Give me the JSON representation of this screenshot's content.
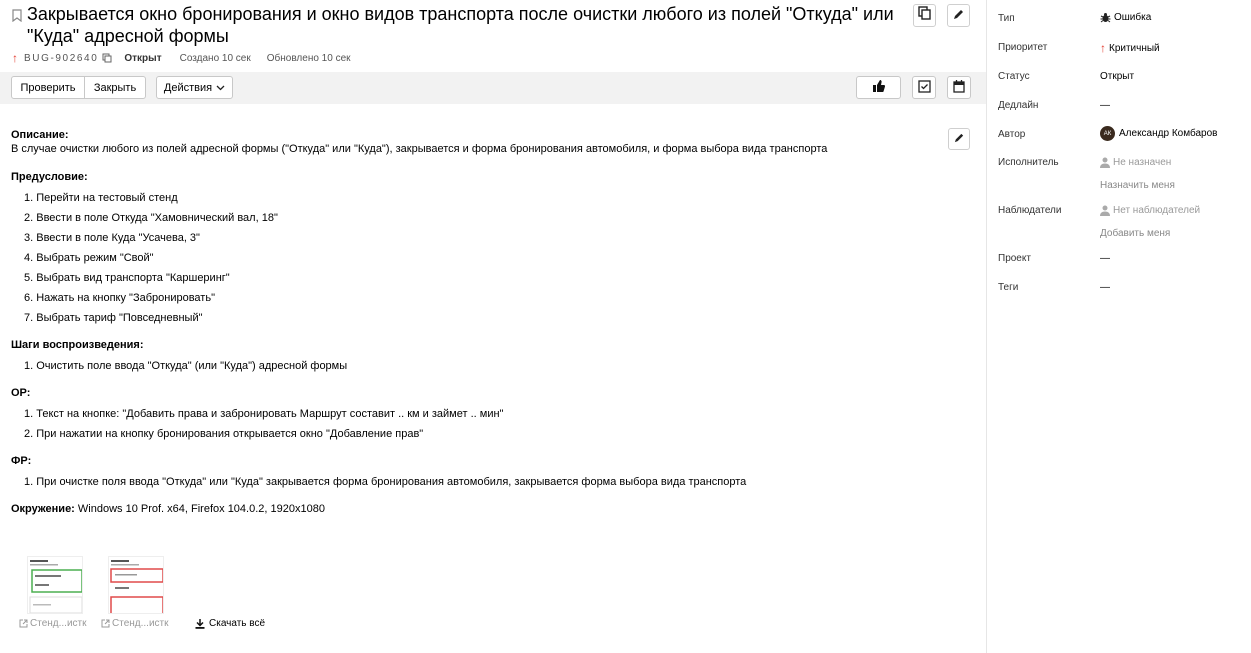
{
  "issue": {
    "title": "Закрывается окно бронирования и окно видов транспорта после очистки любого из полей \"Откуда\" или \"Куда\" адресной формы",
    "key": "BUG-902640",
    "status": "Открыт",
    "created": "Создано 10 сек",
    "updated": "Обновлено 10 сек"
  },
  "toolbar": {
    "check_label": "Проверить",
    "close_label": "Закрыть",
    "actions_label": "Действия"
  },
  "description": {
    "desc_heading": "Описание:",
    "desc_text": "В случае очистки любого из полей адресной формы (\"Откуда\" или \"Куда\"), закрывается и форма бронирования автомобиля, и форма выбора вида транспорта",
    "precondition_heading": "Предусловие:",
    "precondition_steps": [
      "1. Перейти на тестовый стенд",
      "2. Ввести в поле Откуда \"Хамовнический вал, 18\"",
      "3. Ввести в поле Куда \"Усачева, 3\"",
      "4. Выбрать режим \"Свой\"",
      "5. Выбрать вид транспорта \"Каршеринг\"",
      "6. Нажать на кнопку \"Забронировать\"",
      "7. Выбрать тариф \"Повседневный\""
    ],
    "repro_heading": "Шаги воспроизведения:",
    "repro_steps": [
      "1. Очистить поле ввода \"Откуда\" (или \"Куда\") адресной формы"
    ],
    "actual_heading": "ОР:",
    "actual_steps": [
      "1. Текст на кнопке: \"Добавить права и забронировать Маршрут составит .. км и займет .. мин\"",
      "2. При нажатии на кнопку бронирования открывается окно \"Добавление прав\""
    ],
    "expected_heading": "ФР:",
    "expected_steps": [
      "1. При очистке поля ввода \"Откуда\" или \"Куда\" закрывается форма бронирования автомобиля, закрывается форма выбора вида транспорта"
    ],
    "env_heading": "Окружение:",
    "env_text": " Windows 10 Prof. x64, Firefox 104.0.2, 1920x1080"
  },
  "attachments": {
    "items": [
      {
        "label": "Стенд...истк"
      },
      {
        "label": "Стенд...истк"
      }
    ],
    "download_all": "Скачать всё"
  },
  "sidebar": {
    "type_label": "Тип",
    "type_value": "Ошибка",
    "priority_label": "Приоритет",
    "priority_value": "Критичный",
    "status_label": "Статус",
    "status_value": "Открыт",
    "deadline_label": "Дедлайн",
    "deadline_value": "—",
    "author_label": "Автор",
    "author_initials": "АК",
    "author_value": "Александр Комбаров",
    "assignee_label": "Исполнитель",
    "assignee_value": "Не назначен",
    "assign_me": "Назначить меня",
    "watchers_label": "Наблюдатели",
    "watchers_value": "Нет наблюдателей",
    "add_me": "Добавить меня",
    "project_label": "Проект",
    "project_value": "—",
    "tags_label": "Теги",
    "tags_value": "—"
  },
  "colors": {
    "priority_red": "#e23b2e",
    "toolbar_bg": "#f2f2f2"
  }
}
